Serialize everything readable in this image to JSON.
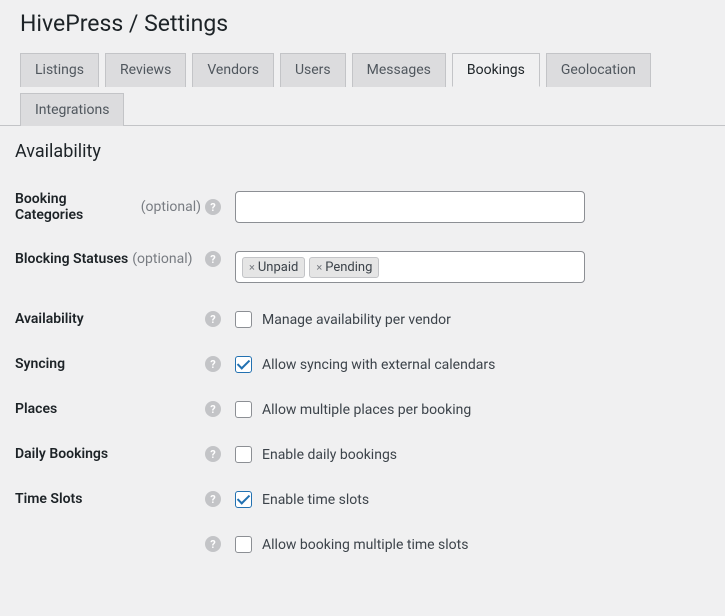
{
  "page": {
    "title": "HivePress / Settings"
  },
  "tabs": [
    {
      "label": "Listings",
      "active": false
    },
    {
      "label": "Reviews",
      "active": false
    },
    {
      "label": "Vendors",
      "active": false
    },
    {
      "label": "Users",
      "active": false
    },
    {
      "label": "Messages",
      "active": false
    },
    {
      "label": "Bookings",
      "active": true
    },
    {
      "label": "Geolocation",
      "active": false
    },
    {
      "label": "Integrations",
      "active": false
    }
  ],
  "section": {
    "heading": "Availability"
  },
  "optionalText": "(optional)",
  "helpGlyph": "?",
  "fields": {
    "bookingCategories": {
      "label": "Booking Categories",
      "optional": true,
      "value": ""
    },
    "blockingStatuses": {
      "label": "Blocking Statuses",
      "optional": true,
      "tags": [
        "Unpaid",
        "Pending"
      ]
    },
    "availability": {
      "label": "Availability",
      "checkboxLabel": "Manage availability per vendor",
      "checked": false
    },
    "syncing": {
      "label": "Syncing",
      "checkboxLabel": "Allow syncing with external calendars",
      "checked": true
    },
    "places": {
      "label": "Places",
      "checkboxLabel": "Allow multiple places per booking",
      "checked": false
    },
    "dailyBookings": {
      "label": "Daily Bookings",
      "checkboxLabel": "Enable daily bookings",
      "checked": false
    },
    "timeSlots": {
      "label": "Time Slots",
      "checkboxLabel": "Enable time slots",
      "checked": true
    },
    "timeSlotsMultiple": {
      "checkboxLabel": "Allow booking multiple time slots",
      "checked": false
    }
  }
}
